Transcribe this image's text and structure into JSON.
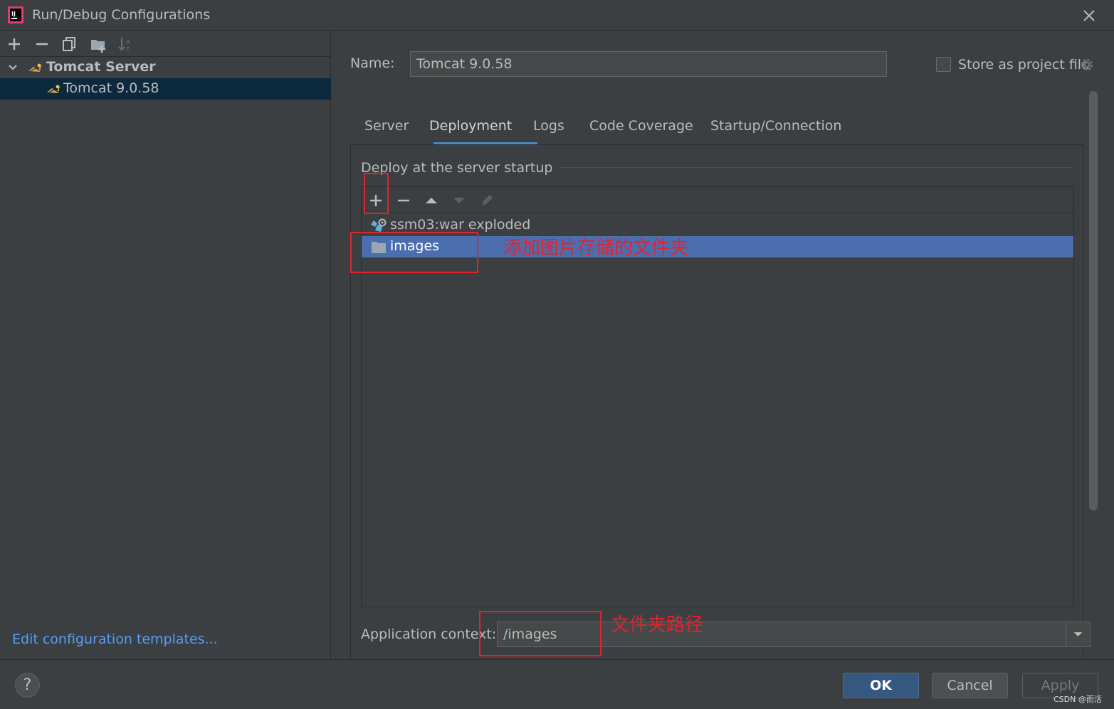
{
  "window": {
    "title": "Run/Debug Configurations"
  },
  "left": {
    "toolbar": [
      "add-icon",
      "remove-icon",
      "copy-icon",
      "new-folder-icon",
      "sort-icon"
    ],
    "tree": [
      {
        "label": "Tomcat Server",
        "bold": true,
        "expanded": true
      },
      {
        "label": "Tomcat 9.0.58",
        "selected": true
      }
    ],
    "edit_templates": "Edit configuration templates..."
  },
  "name": {
    "label": "Name:",
    "value": "Tomcat 9.0.58"
  },
  "store": {
    "label": "Store as project file",
    "checked": false
  },
  "tabs": [
    {
      "label": "Server"
    },
    {
      "label": "Deployment",
      "active": true
    },
    {
      "label": "Logs"
    },
    {
      "label": "Code Coverage"
    },
    {
      "label": "Startup/Connection"
    }
  ],
  "deployment": {
    "section_title": "Deploy at the server startup",
    "items": [
      {
        "label": "ssm03:war exploded",
        "icon": "artifact-icon"
      },
      {
        "label": "images",
        "icon": "folder-icon",
        "selected": true
      }
    ],
    "context_label": "Application context:",
    "context_value": "/images"
  },
  "annotations": {
    "folder_note": "添加图片存储的文件夹",
    "path_note": "文件夹路径"
  },
  "buttons": {
    "help": "?",
    "ok": "OK",
    "cancel": "Cancel",
    "apply": "Apply"
  },
  "watermark": "CSDN @而活",
  "colors": {
    "selection": "#4b6eaf",
    "accent": "#4a88c7",
    "annotation": "#e0242f",
    "link": "#589df6"
  }
}
